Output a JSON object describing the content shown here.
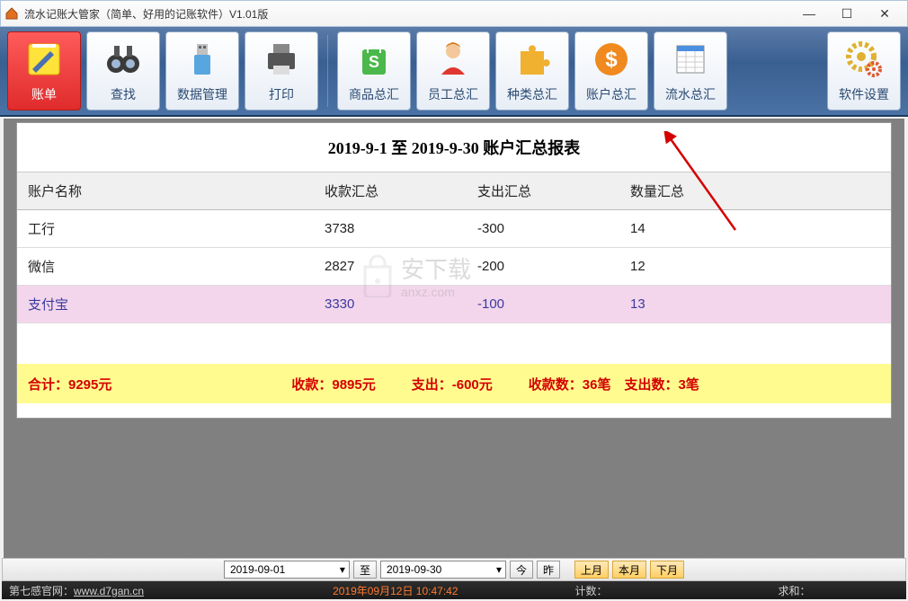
{
  "window": {
    "title": "流水记账大管家（简单、好用的记账软件）V1.01版"
  },
  "toolbar": {
    "bill": "账单",
    "search": "查找",
    "data_mgmt": "数据管理",
    "print": "打印",
    "product_sum": "商品总汇",
    "staff_sum": "员工总汇",
    "category_sum": "种类总汇",
    "account_sum": "账户总汇",
    "flow_sum": "流水总汇",
    "settings": "软件设置"
  },
  "report": {
    "title": "2019-9-1 至 2019-9-30 账户汇总报表",
    "headers": {
      "name": "账户名称",
      "income": "收款汇总",
      "expense": "支出汇总",
      "count": "数量汇总"
    },
    "rows": [
      {
        "name": "工行",
        "income": "3738",
        "expense": "-300",
        "count": "14"
      },
      {
        "name": "微信",
        "income": "2827",
        "expense": "-200",
        "count": "12"
      },
      {
        "name": "支付宝",
        "income": "3330",
        "expense": "-100",
        "count": "13"
      }
    ],
    "totals": {
      "sum": "合计：9295元",
      "income": "收款：9895元",
      "expense": "支出：-600元",
      "counts": "收款数：36笔　支出数：3笔"
    }
  },
  "date_bar": {
    "from": "2019-09-01",
    "to_label": "至",
    "to": "2019-09-30",
    "today": "今",
    "yesterday": "昨",
    "last_month": "上月",
    "this_month": "本月",
    "next_month": "下月"
  },
  "status": {
    "site_label": "第七感官网：",
    "site_url": "www.d7gan.cn",
    "datetime": "2019年09月12日  10:47:42",
    "count_label": "计数：",
    "balance_label": "求和："
  },
  "watermark": {
    "text1": "安下载",
    "text2": "anxz.com"
  }
}
